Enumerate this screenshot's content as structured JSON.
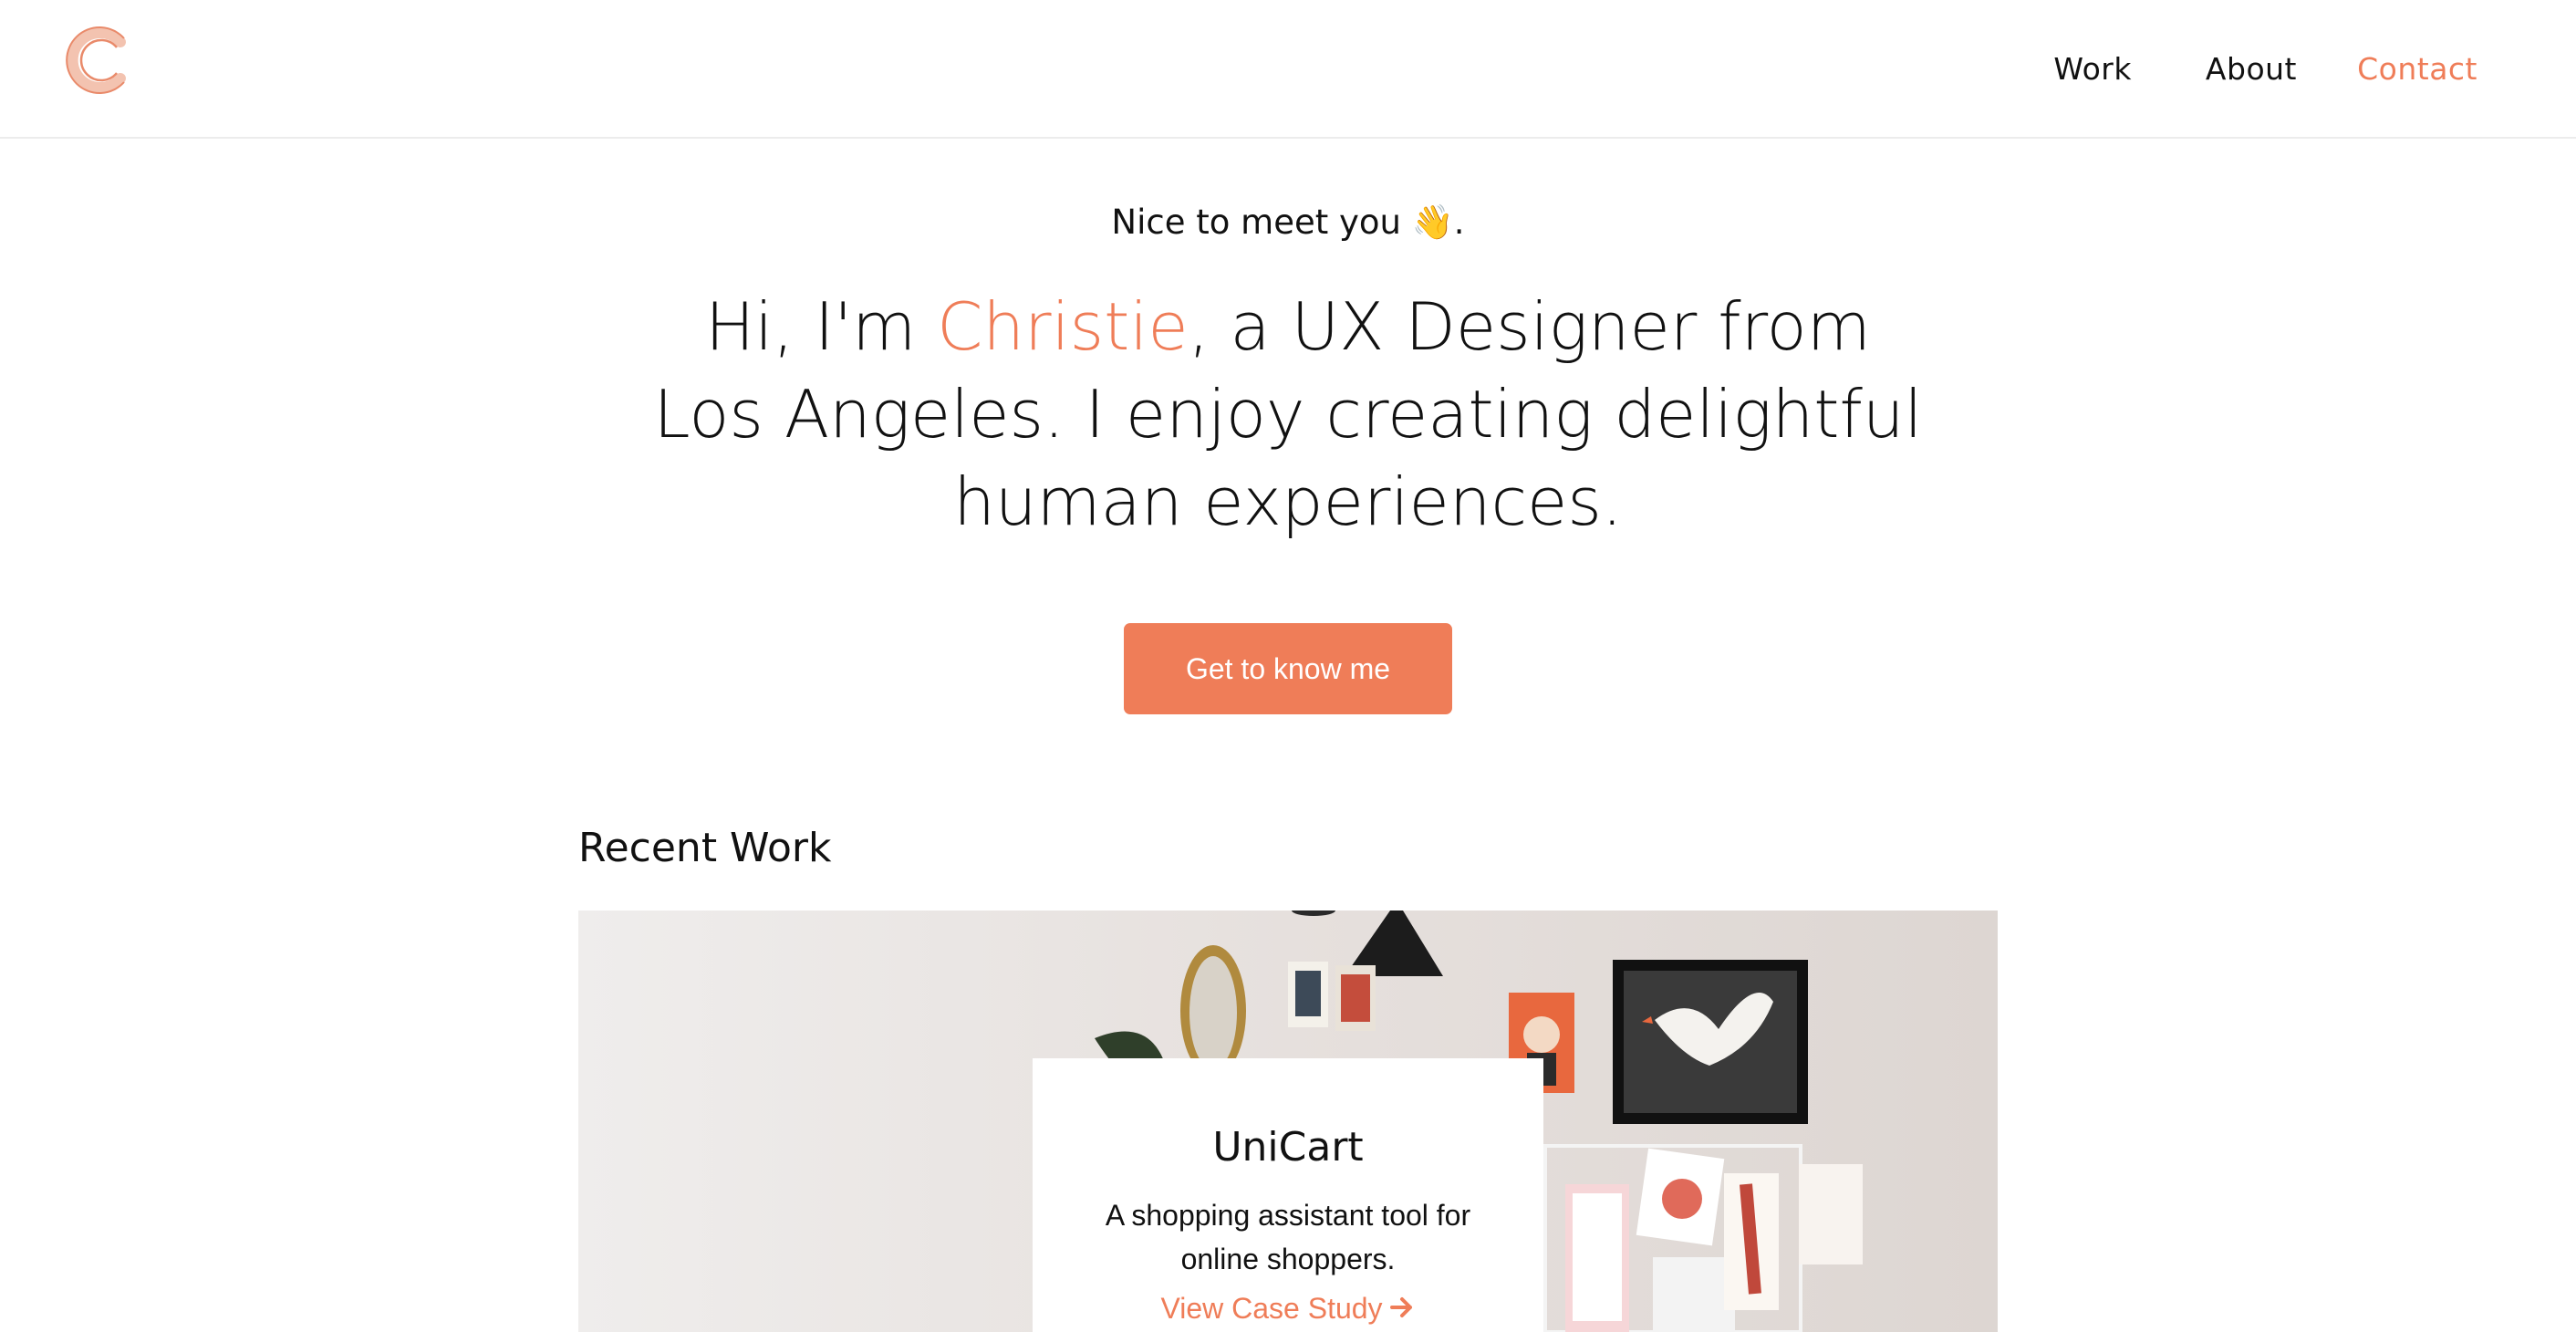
{
  "header": {
    "logo_icon": "c-monogram-logo",
    "nav": [
      {
        "label": "Work"
      },
      {
        "label": "About"
      },
      {
        "label": "Contact"
      }
    ]
  },
  "hero": {
    "greeting": "Nice to meet you 👋.",
    "headline_before": "Hi, I'm ",
    "headline_name": "Christie",
    "headline_after": ", a UX Designer from Los Angeles. I enjoy creating delightful human experiences.",
    "cta_label": "Get to know me"
  },
  "recent_work": {
    "title": "Recent Work",
    "project": {
      "title": "UniCart",
      "description": "A shopping assistant tool for online shoppers.",
      "link_label": "View Case Study",
      "link_icon": "arrow-right-icon"
    }
  },
  "colors": {
    "accent": "#ef7d58",
    "text": "#111111",
    "background": "#ffffff"
  }
}
